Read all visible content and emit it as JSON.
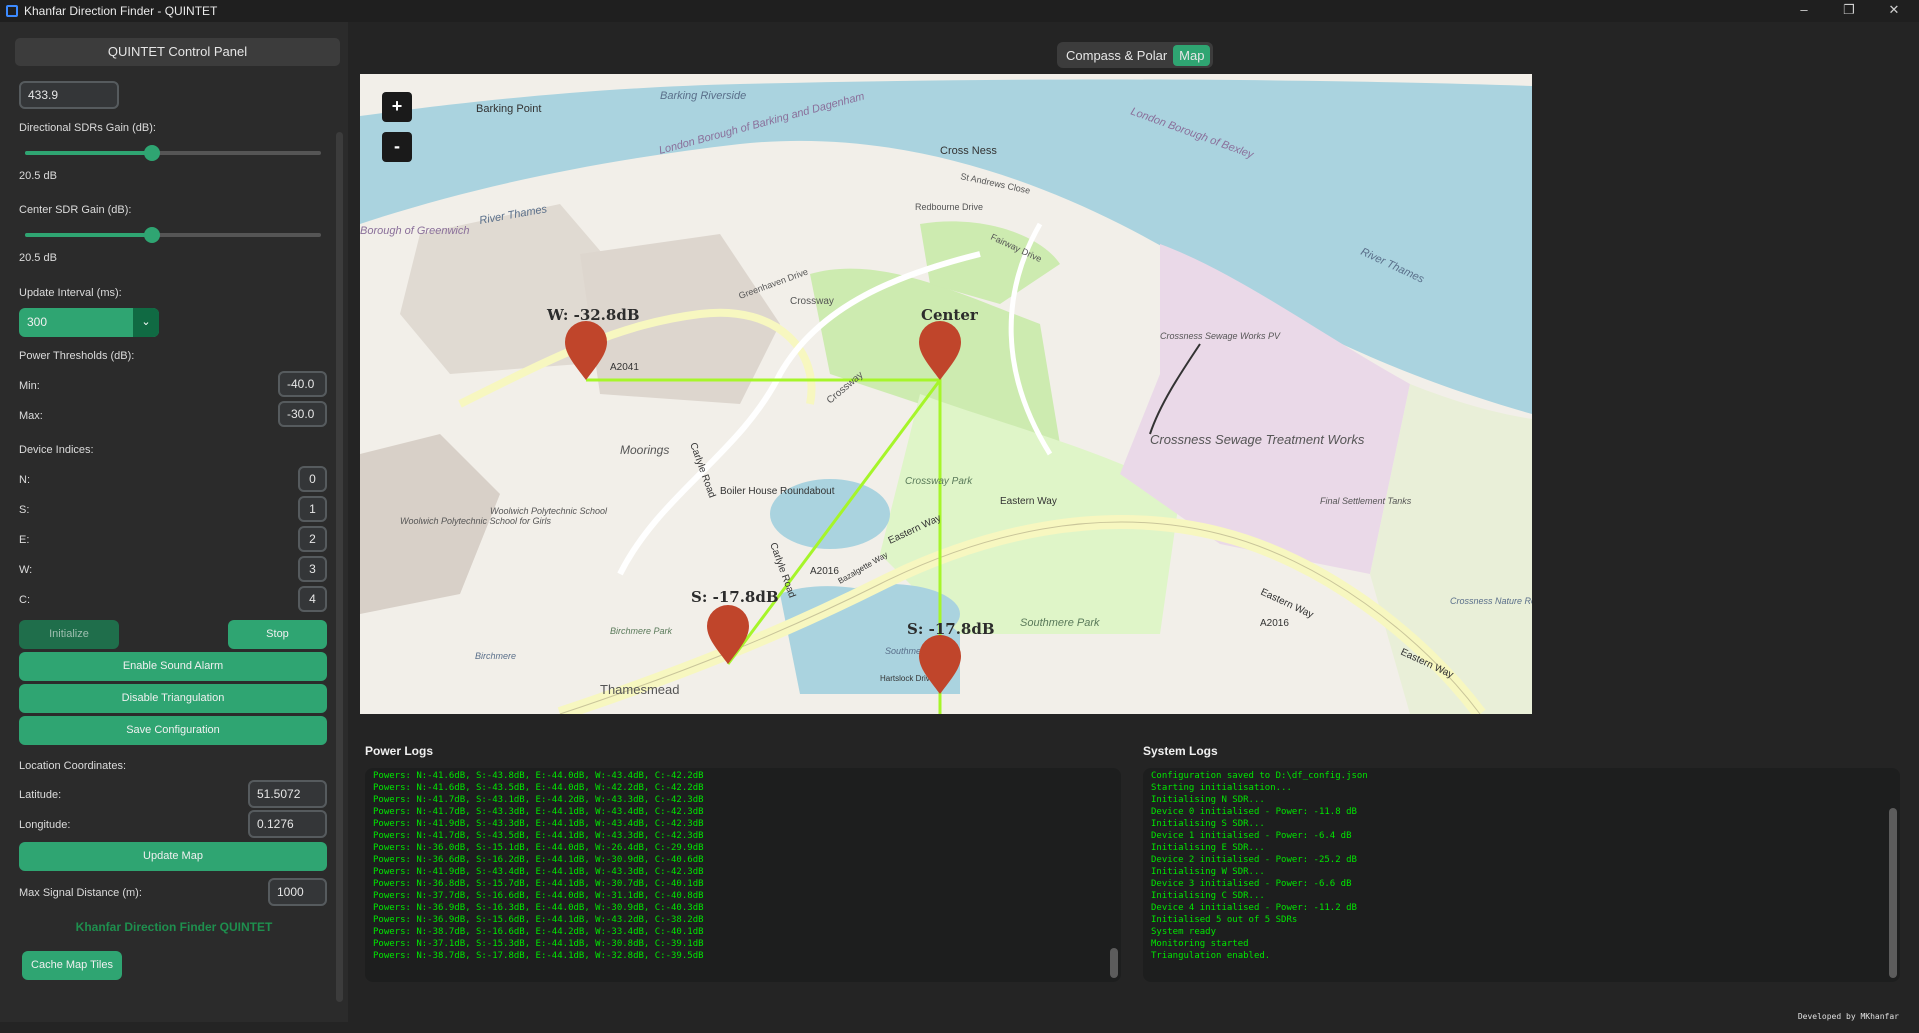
{
  "window": {
    "title": "Khanfar Direction Finder - QUINTET"
  },
  "panel": {
    "header": "QUINTET Control Panel",
    "frequency": "433.9",
    "dir_gain_label": "Directional SDRs Gain (dB):",
    "dir_gain_value": "20.5 dB",
    "center_gain_label": "Center SDR Gain (dB):",
    "center_gain_value": "20.5 dB",
    "interval_label": "Update Interval (ms):",
    "interval_value": "300",
    "thresholds_label": "Power Thresholds (dB):",
    "min_label": "Min:",
    "min_value": "-40.0",
    "max_label": "Max:",
    "max_value": "-30.0",
    "indices_label": "Device Indices:",
    "indices": [
      {
        "label": "N:",
        "value": "0"
      },
      {
        "label": "S:",
        "value": "1"
      },
      {
        "label": "E:",
        "value": "2"
      },
      {
        "label": "W:",
        "value": "3"
      },
      {
        "label": "C:",
        "value": "4"
      }
    ],
    "initialize": "Initialize",
    "stop": "Stop",
    "sound_alarm": "Enable Sound Alarm",
    "triangulation": "Disable Triangulation",
    "save_config": "Save Configuration",
    "location_label": "Location Coordinates:",
    "lat_label": "Latitude:",
    "lat_value": "51.5072",
    "lon_label": "Longitude:",
    "lon_value": "0.1276",
    "update_map": "Update Map",
    "max_dist_label": "Max Signal Distance (m):",
    "max_dist_value": "1000",
    "brand": "Khanfar Direction Finder QUINTET",
    "cache_tiles": "Cache Map Tiles"
  },
  "tabs": [
    "Compass & Polar",
    "Map"
  ],
  "active_tab": "Map",
  "map": {
    "markers": [
      {
        "label": "W: -32.8dB"
      },
      {
        "label": "Center"
      },
      {
        "label": "S: -17.8dB"
      },
      {
        "label": "S: -17.8dB"
      }
    ],
    "places": [
      "Barking Riverside",
      "Barking Point",
      "London Borough of Barking and Dagenham",
      "London Borough of Bexley",
      "Cross Ness",
      "St Andrews Close",
      "Redbourne Drive",
      "Fairway Drive",
      "River Thames",
      "River Thames",
      "Borough of Greenwich",
      "Greenhaven Drive",
      "Crossway",
      "Crossway",
      "Crossness Sewage Works PV",
      "Crossness Sewage Treatment Works",
      "Final Settlement Tanks",
      "Crossway Park",
      "Eastern Way",
      "Eastern Way",
      "Eastern Way",
      "Eastern Way",
      "Moorings",
      "Boiler House Roundabout",
      "Carlyle Road",
      "Carlyle Road",
      "A2041",
      "A2016",
      "A2016",
      "Woolwich Polytechnic School for Girls",
      "Woolwich Polytechnic School",
      "Southmere Park",
      "Birchmere Park",
      "Birchmere",
      "Thamesmead",
      "Crossness Nature Reserve",
      "Hartslock Drive",
      "Southmere",
      "Bazalgette Way"
    ],
    "zoom_in": "+",
    "zoom_out": "-"
  },
  "power_logs": {
    "title": "Power Logs",
    "lines": [
      "Powers: N:-41.6dB, S:-43.8dB, E:-44.0dB, W:-43.4dB, C:-42.2dB",
      "Powers: N:-41.6dB, S:-43.5dB, E:-44.0dB, W:-42.2dB, C:-42.2dB",
      "Powers: N:-41.7dB, S:-43.1dB, E:-44.2dB, W:-43.3dB, C:-42.3dB",
      "Powers: N:-41.7dB, S:-43.3dB, E:-44.1dB, W:-43.4dB, C:-42.3dB",
      "Powers: N:-41.9dB, S:-43.3dB, E:-44.1dB, W:-43.4dB, C:-42.3dB",
      "Powers: N:-41.7dB, S:-43.5dB, E:-44.1dB, W:-43.3dB, C:-42.3dB",
      "Powers: N:-36.0dB, S:-15.1dB, E:-44.0dB, W:-26.4dB, C:-29.9dB",
      "Powers: N:-36.6dB, S:-16.2dB, E:-44.1dB, W:-30.9dB, C:-40.6dB",
      "Powers: N:-41.9dB, S:-43.4dB, E:-44.1dB, W:-43.3dB, C:-42.3dB",
      "Powers: N:-36.8dB, S:-15.7dB, E:-44.1dB, W:-30.7dB, C:-40.1dB",
      "Powers: N:-37.7dB, S:-16.6dB, E:-44.0dB, W:-31.1dB, C:-40.8dB",
      "Powers: N:-36.9dB, S:-16.3dB, E:-44.0dB, W:-30.9dB, C:-40.3dB",
      "Powers: N:-36.9dB, S:-15.6dB, E:-44.1dB, W:-43.2dB, C:-38.2dB",
      "Powers: N:-38.7dB, S:-16.6dB, E:-44.2dB, W:-33.4dB, C:-40.1dB",
      "Powers: N:-37.1dB, S:-15.3dB, E:-44.1dB, W:-30.8dB, C:-39.1dB",
      "Powers: N:-38.7dB, S:-17.8dB, E:-44.1dB, W:-32.8dB, C:-39.5dB"
    ]
  },
  "system_logs": {
    "title": "System Logs",
    "lines": [
      "Configuration saved to D:\\df_config.json",
      "Starting initialisation...",
      "Initialising N SDR...",
      "Device 0 initialised - Power: -11.8 dB",
      "Initialising S SDR...",
      "Device 1 initialised - Power: -6.4 dB",
      "Initialising E SDR...",
      "Device 2 initialised - Power: -25.2 dB",
      "Initialising W SDR...",
      "Device 3 initialised - Power: -6.6 dB",
      "Initialising C SDR...",
      "Device 4 initialised - Power: -11.2 dB",
      "Initialised 5 out of 5 SDRs",
      "System ready",
      "Monitoring started",
      "Triangulation enabled."
    ]
  },
  "footer": "Developed by MKhanfar",
  "colors": {
    "accent": "#2fa572",
    "log_text": "#00e600",
    "marker": "#c0452b",
    "line": "#a6f52a"
  }
}
